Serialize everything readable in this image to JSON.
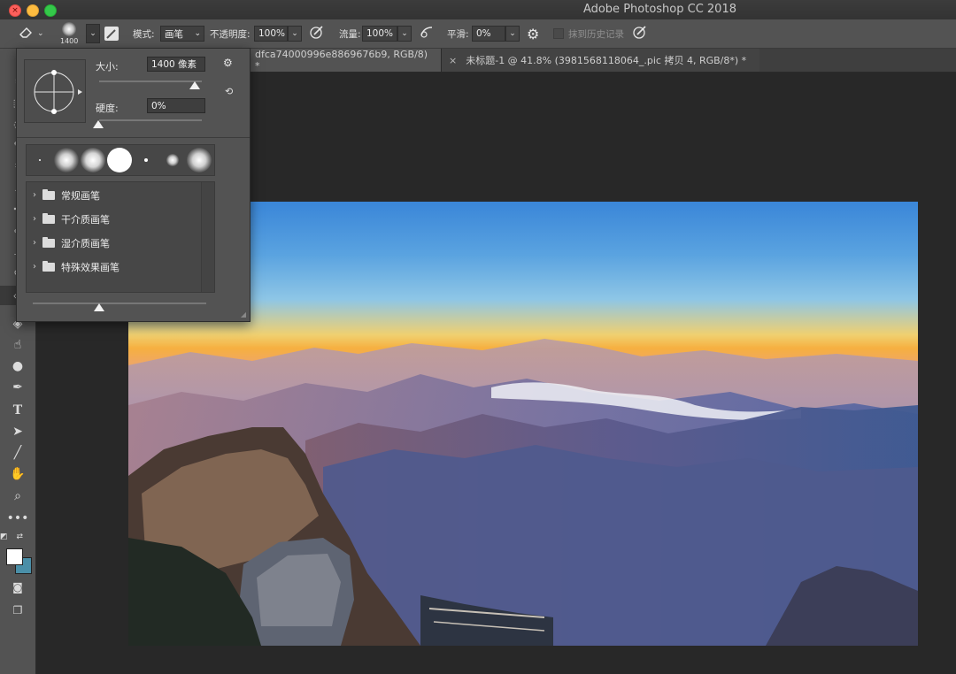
{
  "window": {
    "title": "Adobe Photoshop CC 2018"
  },
  "options_bar": {
    "brush_size_preview": "1400",
    "mode_label": "模式:",
    "mode_value": "画笔",
    "opacity_label": "不透明度:",
    "opacity_value": "100%",
    "flow_label": "流量:",
    "flow_value": "100%",
    "smoothing_label": "平滑:",
    "smoothing_value": "0%",
    "erase_history_label": "抹到历史记录"
  },
  "tabs": [
    {
      "label": "dfca74000996e8869676b9, RGB/8) *",
      "active": true
    },
    {
      "label": "未标题-1 @ 41.8% (3981568118064_.pic 拷贝 4, RGB/8*) *",
      "active": false
    }
  ],
  "brush_panel": {
    "size_label": "大小:",
    "size_value": "1400 像素",
    "hardness_label": "硬度:",
    "hardness_value": "0%",
    "folders": [
      {
        "label": "常规画笔"
      },
      {
        "label": "干介质画笔"
      },
      {
        "label": "湿介质画笔"
      },
      {
        "label": "特殊效果画笔"
      }
    ]
  },
  "colors": {
    "foreground": "#ffffff",
    "background": "#4a8fa8"
  },
  "tools": [
    "eraser-tool",
    "paint-bucket-tool",
    "smudge-tool",
    "dodge-tool",
    "pen-tool",
    "type-tool",
    "path-selection-tool",
    "line-tool",
    "hand-tool",
    "zoom-tool",
    "more-tools"
  ]
}
